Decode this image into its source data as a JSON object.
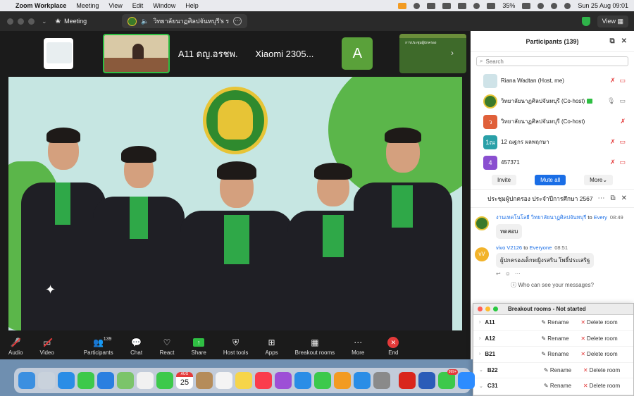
{
  "menubar": {
    "app": "Zoom Workplace",
    "items": [
      "Meeting",
      "View",
      "Edit",
      "Window",
      "Help"
    ],
    "battery": "35%",
    "datetime": "Sun 25 Aug  09:01"
  },
  "window": {
    "meeting_label": "Meeting",
    "title": "วิทยาลัยนาฏศิลปจันทบุรี's ร",
    "view_label": "View"
  },
  "strip": {
    "names": [
      "A11 ดญ.อรชพ...",
      "Xiaomi 2305..."
    ],
    "avatar_letter": "A",
    "slide_text": "การประชุมผู้ปกครอง"
  },
  "controls": {
    "audio": "Audio",
    "video": "Video",
    "participants": "Participants",
    "participants_count": "139",
    "chat": "Chat",
    "react": "React",
    "share": "Share",
    "host_tools": "Host tools",
    "apps": "Apps",
    "breakout": "Breakout rooms",
    "more": "More",
    "end": "End"
  },
  "participants_panel": {
    "title": "Participants (139)",
    "search_placeholder": "Search",
    "rows": [
      {
        "name": "Riana Wadtan (Host, me)",
        "avatar": "",
        "color": "#cfe3e8"
      },
      {
        "name": "วิทยาลัยนาฏศิลปจันทบุรี (Co-host)",
        "avatar": "",
        "color": "#3b7a2a"
      },
      {
        "name": "วิทยาลัยนาฏศิลปจันทบุรี (Co-host)",
        "avatar": "ว",
        "color": "#e0603a"
      },
      {
        "name": "12 ณฐกร ผลพฤกษา",
        "avatar": "1ณ",
        "color": "#2aa0a8"
      },
      {
        "name": "457371",
        "avatar": "4",
        "color": "#8a4fd0"
      }
    ],
    "invite": "Invite",
    "mute_all": "Mute all",
    "more": "More"
  },
  "chat": {
    "title": "ประชุมผู้ปกครอง ประจำปีการศึกษา 2567",
    "messages": [
      {
        "sender": "งานเทคโนโลยี วิทยาลัยนาฏศิลปจันทบุรี",
        "to": "to",
        "recipient": "Every",
        "time": "08:49",
        "text": "ทดสอบ",
        "avatar": ""
      },
      {
        "sender": "vivo V2126",
        "to": "to",
        "recipient": "Everyone",
        "time": "08:51",
        "text": "ผู้ปกครองเด็กหญิงรสริน  โพธิ์ประเสริฐ",
        "avatar": "vV"
      }
    ],
    "who_can_see": "Who can see your messages?"
  },
  "breakout": {
    "title": "Breakout rooms - Not started",
    "rename": "Rename",
    "delete": "Delete room",
    "rooms": [
      "A11",
      "A12",
      "B21",
      "B22",
      "C31"
    ]
  },
  "dock": {
    "cal_month": "AUG",
    "cal_day": "25",
    "badge": "999+"
  }
}
